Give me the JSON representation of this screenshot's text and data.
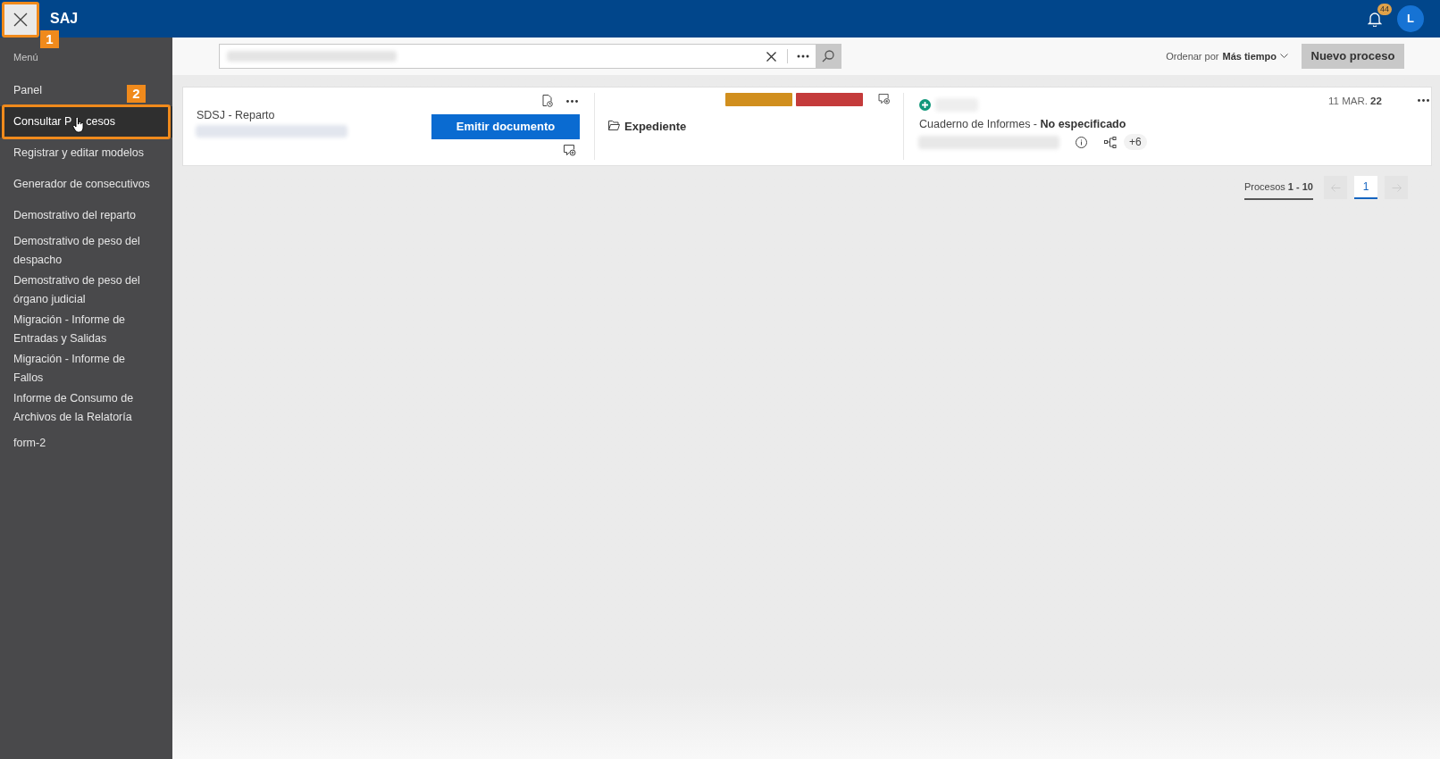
{
  "app": {
    "title": "SAJ",
    "notifications": "44",
    "avatar": "L"
  },
  "annotations": [
    {
      "label": "1"
    },
    {
      "label": "2"
    }
  ],
  "sidebar": {
    "heading": "Menú",
    "items": [
      {
        "lines": [
          "Panel"
        ],
        "selected": false
      },
      {
        "parts": [
          "Consultar P",
          "cesos"
        ],
        "selected": true
      },
      {
        "lines": [
          "Registrar y editar modelos"
        ],
        "selected": false
      },
      {
        "lines": [
          "Generador de consecutivos"
        ],
        "selected": false
      },
      {
        "lines": [
          "Demostrativo del reparto"
        ],
        "selected": false
      },
      {
        "lines": [
          "Demostrativo de peso del",
          "despacho"
        ],
        "selected": false
      },
      {
        "lines": [
          "Demostrativo de peso del",
          "órgano judicial"
        ],
        "selected": false
      },
      {
        "lines": [
          "Migración - Informe de",
          "Entradas y Salidas"
        ],
        "selected": false
      },
      {
        "lines": [
          "Migración - Informe de",
          "Fallos"
        ],
        "selected": false
      },
      {
        "lines": [
          "Informe de Consumo de",
          "Archivos de la Relatoría"
        ],
        "selected": false
      },
      {
        "lines": [
          "form-2"
        ],
        "selected": false
      }
    ]
  },
  "toolbar": {
    "sort_label": "Ordenar por",
    "sort_value": "Más tiempo",
    "new_button": "Nuevo proceso"
  },
  "process_cards": [
    {
      "office": "SDSJ - Reparto",
      "emit_button": "Emitir documento",
      "folder": "Expediente",
      "tags": [
        {
          "color": "#d18f1e"
        },
        {
          "color": "#c43b3b"
        }
      ],
      "notebook": "Cuaderno de Informes",
      "notebook_separator": "-",
      "notebook_status": "No especificado",
      "extra_count": "+6",
      "date": "11 MAR.",
      "date_year": "22"
    }
  ],
  "pagination": {
    "label": "Procesos",
    "range": "1 - 10",
    "pages": [
      {
        "label": "1",
        "selected": true
      }
    ]
  }
}
